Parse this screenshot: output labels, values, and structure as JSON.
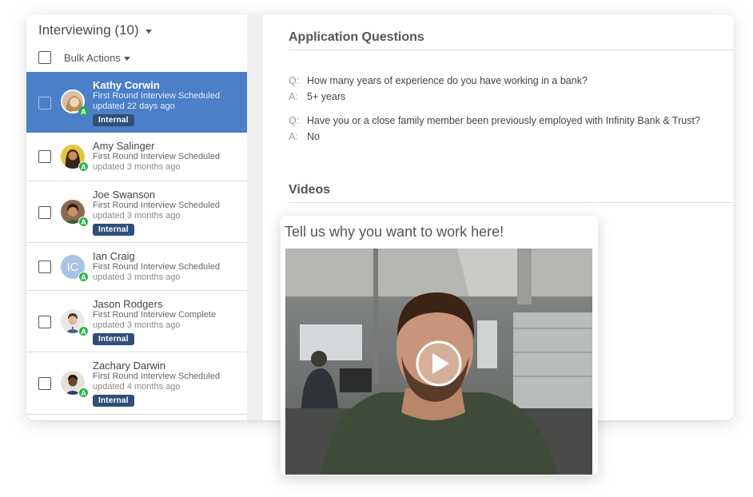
{
  "sidebar": {
    "header_label": "Interviewing (10)",
    "bulk_actions_label": "Bulk Actions",
    "candidates": [
      {
        "name": "Kathy Corwin",
        "status": "First Round Interview Scheduled",
        "updated": "updated 22 days ago",
        "tag": "Internal",
        "avatar": "photo",
        "selected": true
      },
      {
        "name": "Amy Salinger",
        "status": "First Round Interview Scheduled",
        "updated": "updated 3 months ago",
        "tag": "",
        "avatar": "photo"
      },
      {
        "name": "Joe Swanson",
        "status": "First Round Interview Scheduled",
        "updated": "updated 3 months ago",
        "tag": "Internal",
        "avatar": "photo"
      },
      {
        "name": "Ian Craig",
        "status": "First Round Interview Scheduled",
        "updated": "updated 3 months ago",
        "tag": "",
        "avatar": "initials",
        "initials": "IC"
      },
      {
        "name": "Jason Rodgers",
        "status": "First Round Interview Complete",
        "updated": "updated 3 months ago",
        "tag": "Internal",
        "avatar": "photo"
      },
      {
        "name": "Zachary Darwin",
        "status": "First Round Interview Scheduled",
        "updated": "updated 4 months ago",
        "tag": "Internal",
        "avatar": "photo"
      }
    ],
    "assessment_badge": "A"
  },
  "main": {
    "application_questions_title": "Application Questions",
    "q_prefix": "Q:",
    "a_prefix": "A:",
    "qa": [
      {
        "q": "How many years of experience do you have working in a bank?",
        "a": "5+ years"
      },
      {
        "q": "Have you or a close family member been previously employed with Infinity Bank & Trust?",
        "a": "No"
      }
    ],
    "videos_title": "Videos"
  },
  "video": {
    "prompt": "Tell us why you want to work here!",
    "play_icon": "play-icon"
  },
  "colors": {
    "selected_row": "#4b7fc8",
    "tag_bg": "#2f4f7a",
    "badge_green": "#2fb34a"
  }
}
